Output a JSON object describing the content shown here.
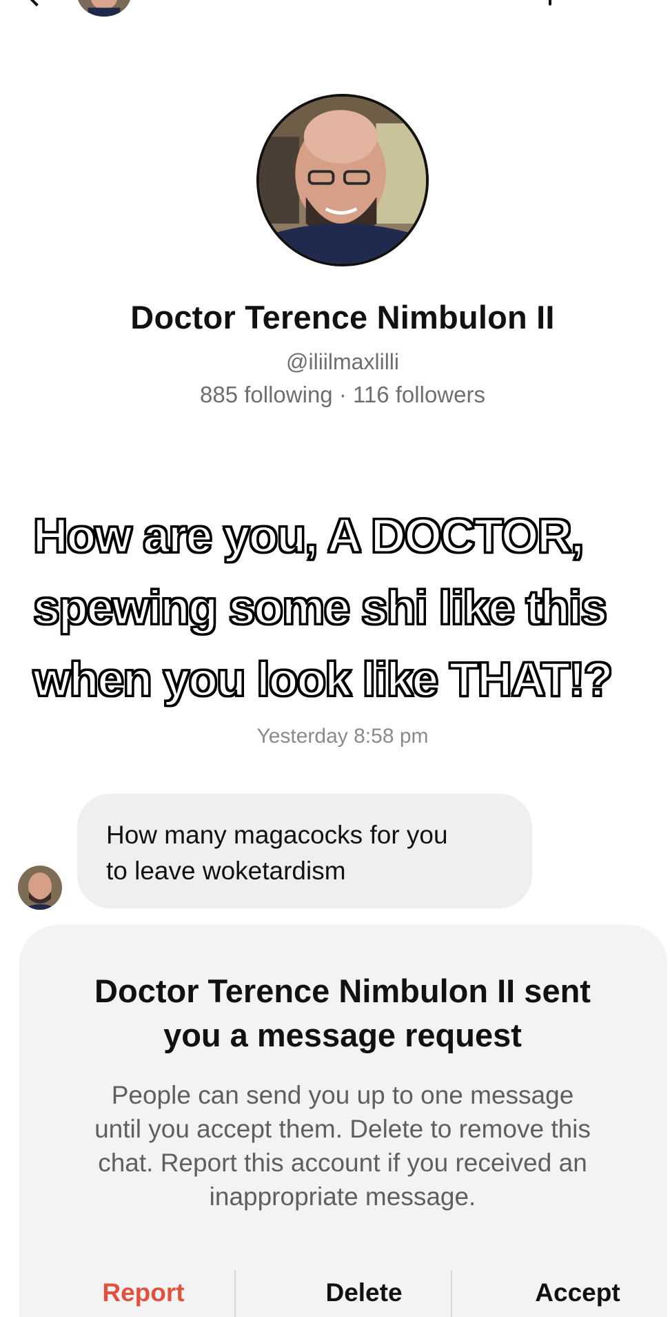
{
  "profile": {
    "name": "Doctor Terence Nimbulon II",
    "handle": "@iliilmaxlilli",
    "stats": "885 following · 116 followers"
  },
  "caption": {
    "lines": [
      "How are you, A DOCTOR,",
      "spewing some shi like this",
      "when you look like THAT!?"
    ]
  },
  "chat": {
    "timestamp": "Yesterday 8:58 pm",
    "message": {
      "line1": "How many magacocks for you",
      "line2": "to leave woketardism"
    }
  },
  "request": {
    "title_line1": "Doctor Terence Nimbulon II sent",
    "title_line2": "you a message request",
    "body_line1": "People can send you up to one message",
    "body_line2": "until you accept them. Delete to remove this",
    "body_line3": "chat. Report this account if you received an",
    "body_line4": "inappropriate message.",
    "report_label": "Report",
    "delete_label": "Delete",
    "accept_label": "Accept"
  },
  "colors": {
    "report": "#e0513e",
    "panel_bg": "#f3f3f3",
    "bubble_bg": "#efefef"
  },
  "icons": {
    "back": "back-chevron-icon",
    "more": "more-icon"
  }
}
